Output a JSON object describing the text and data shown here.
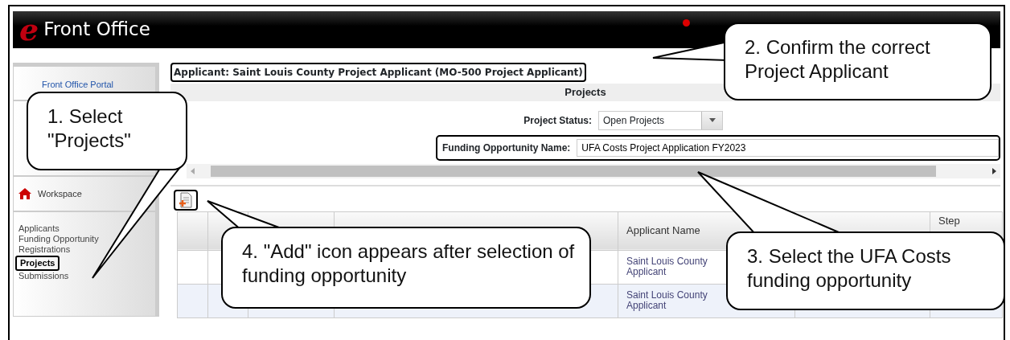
{
  "header": {
    "logo_letter": "e",
    "title": "Front Office",
    "notification": true
  },
  "sidebar": {
    "portal_link": "Front Office Portal",
    "workspace": {
      "label": "Workspace"
    },
    "items": [
      {
        "label": "Applicants",
        "selected": false
      },
      {
        "label": "Funding Opportunity Registrations",
        "selected": false
      },
      {
        "label": "Projects",
        "selected": true
      },
      {
        "label": "Submissions",
        "selected": false
      }
    ]
  },
  "main": {
    "applicant": "Applicant: Saint Louis County Project Applicant (MO-500 Project Applicant)",
    "page_title": "Projects",
    "project_status": {
      "label": "Project Status:",
      "value": "Open Projects"
    },
    "funding_opportunity": {
      "label": "Funding Opportunity Name:",
      "value": "UFA Costs Project Application FY2023"
    },
    "table": {
      "columns": [
        {
          "kind": "applicant_name",
          "label": "Applicant Name"
        },
        {
          "kind": "step",
          "label": "Step"
        }
      ],
      "rows": [
        {
          "applicant_name": "Saint Louis County Applicant"
        },
        {
          "applicant_name": "Saint Louis County Applicant"
        }
      ]
    }
  },
  "callouts": [
    {
      "kind": "sidebar",
      "text": "1. Select \"Projects\""
    },
    {
      "kind": "applicant",
      "text": "2. Confirm the correct Project Applicant"
    },
    {
      "kind": "add",
      "text": "4. \"Add\" icon appears after selection of funding opportunity"
    },
    {
      "kind": "funding",
      "text": "3. Select the UFA Costs funding opportunity"
    }
  ]
}
